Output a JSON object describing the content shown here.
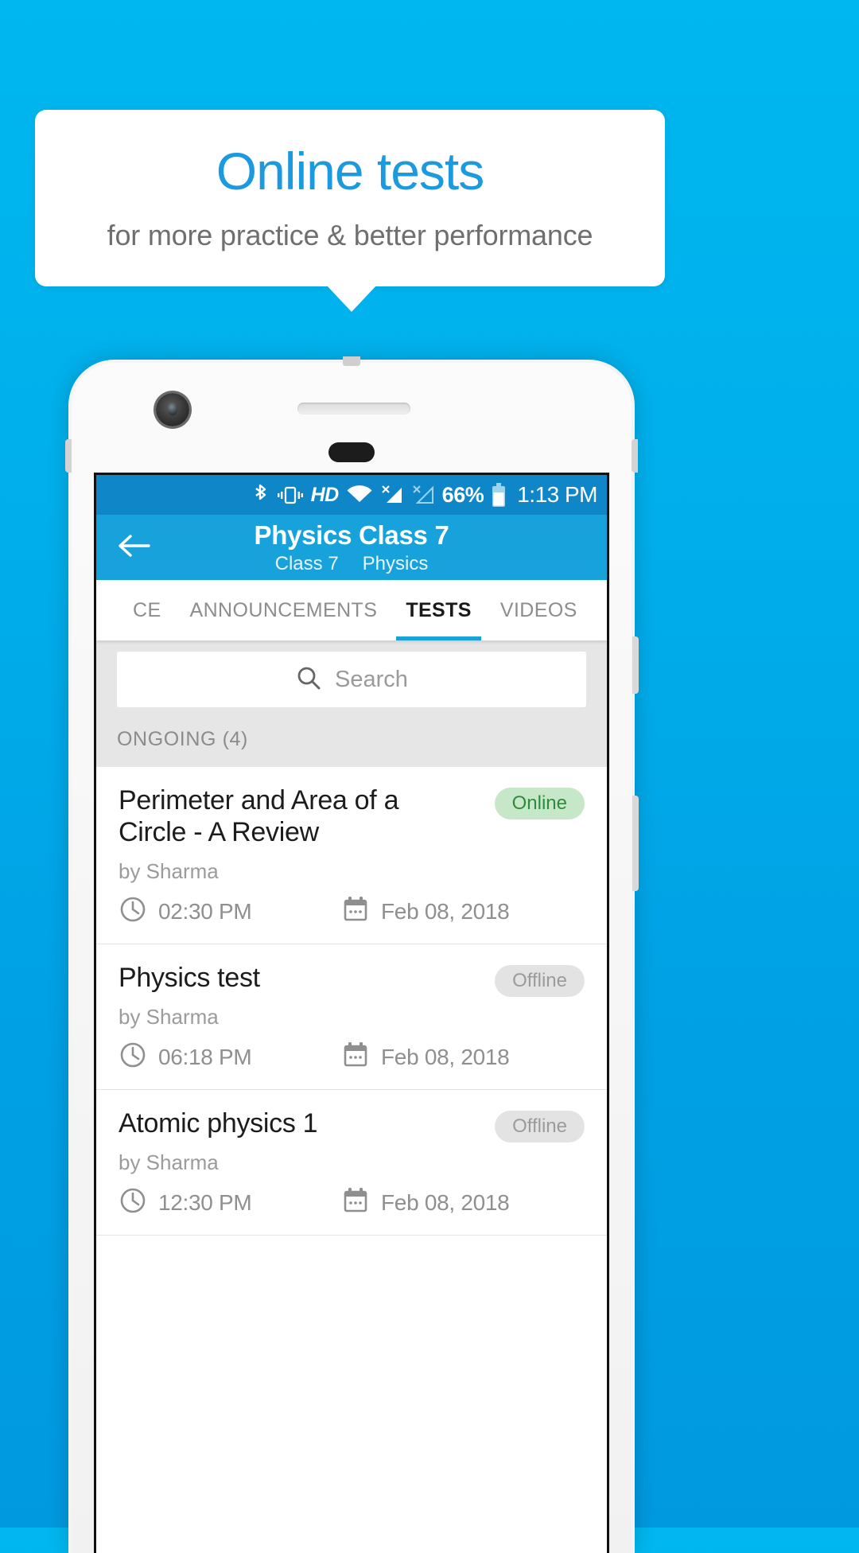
{
  "callout": {
    "title": "Online tests",
    "subtitle": "for more practice & better performance"
  },
  "colors": {
    "background": "#00aeeb",
    "title_blue": "#1b9ae0",
    "appbar_blue": "#17a2dc",
    "statusbar_blue": "#0e86c8",
    "badge_online_bg": "#c6e8c8",
    "badge_online_text": "#2e8b3d",
    "badge_offline_bg": "#e3e3e3",
    "badge_offline_text": "#9b9b9b"
  },
  "statusbar": {
    "icons": [
      "bluetooth-icon",
      "vibrate-icon",
      "hd-icon",
      "wifi-icon",
      "signal-icon",
      "signal-off-icon"
    ],
    "hd_label": "HD",
    "battery_percent": "66%",
    "time": "1:13 PM"
  },
  "appbar": {
    "back_icon": "back-arrow-icon",
    "title": "Physics Class 7",
    "subtitle_class": "Class 7",
    "subtitle_subject": "Physics"
  },
  "tabs": [
    {
      "label": "CE",
      "active": false
    },
    {
      "label": "ANNOUNCEMENTS",
      "active": false
    },
    {
      "label": "TESTS",
      "active": true
    },
    {
      "label": "VIDEOS",
      "active": false
    }
  ],
  "search": {
    "icon": "search-icon",
    "placeholder": "Search",
    "value": ""
  },
  "section": {
    "header": "ONGOING (4)"
  },
  "tests": [
    {
      "title": "Perimeter and Area of a Circle - A Review",
      "author": "by Sharma",
      "time": "02:30 PM",
      "date": "Feb 08, 2018",
      "status": "Online",
      "status_type": "online"
    },
    {
      "title": "Physics test",
      "author": "by Sharma",
      "time": "06:18 PM",
      "date": "Feb 08, 2018",
      "status": "Offline",
      "status_type": "offline"
    },
    {
      "title": "Atomic physics 1",
      "author": "by Sharma",
      "time": "12:30 PM",
      "date": "Feb 08, 2018",
      "status": "Offline",
      "status_type": "offline"
    }
  ]
}
